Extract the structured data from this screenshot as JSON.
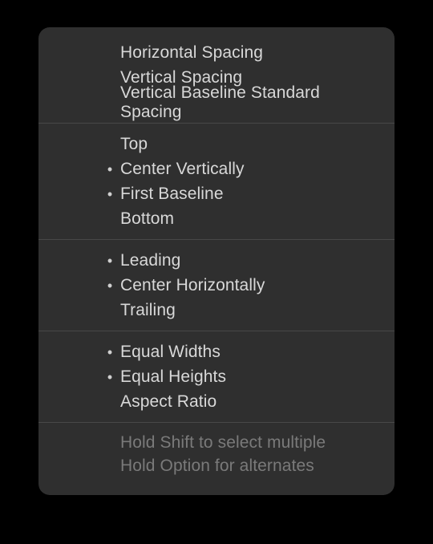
{
  "menu": {
    "groups": [
      {
        "items": [
          {
            "label": "Horizontal Spacing",
            "selected": false
          },
          {
            "label": "Vertical Spacing",
            "selected": false
          },
          {
            "label": "Vertical Baseline Standard Spacing",
            "selected": false
          }
        ]
      },
      {
        "items": [
          {
            "label": "Top",
            "selected": false
          },
          {
            "label": "Center Vertically",
            "selected": true
          },
          {
            "label": "First Baseline",
            "selected": true
          },
          {
            "label": "Bottom",
            "selected": false
          }
        ]
      },
      {
        "items": [
          {
            "label": "Leading",
            "selected": true
          },
          {
            "label": "Center Horizontally",
            "selected": true
          },
          {
            "label": "Trailing",
            "selected": false
          }
        ]
      },
      {
        "items": [
          {
            "label": "Equal Widths",
            "selected": true
          },
          {
            "label": "Equal Heights",
            "selected": true
          },
          {
            "label": "Aspect Ratio",
            "selected": false
          }
        ]
      }
    ],
    "hints": [
      "Hold Shift to select multiple",
      "Hold Option for alternates"
    ],
    "bullet_glyph": "•"
  }
}
